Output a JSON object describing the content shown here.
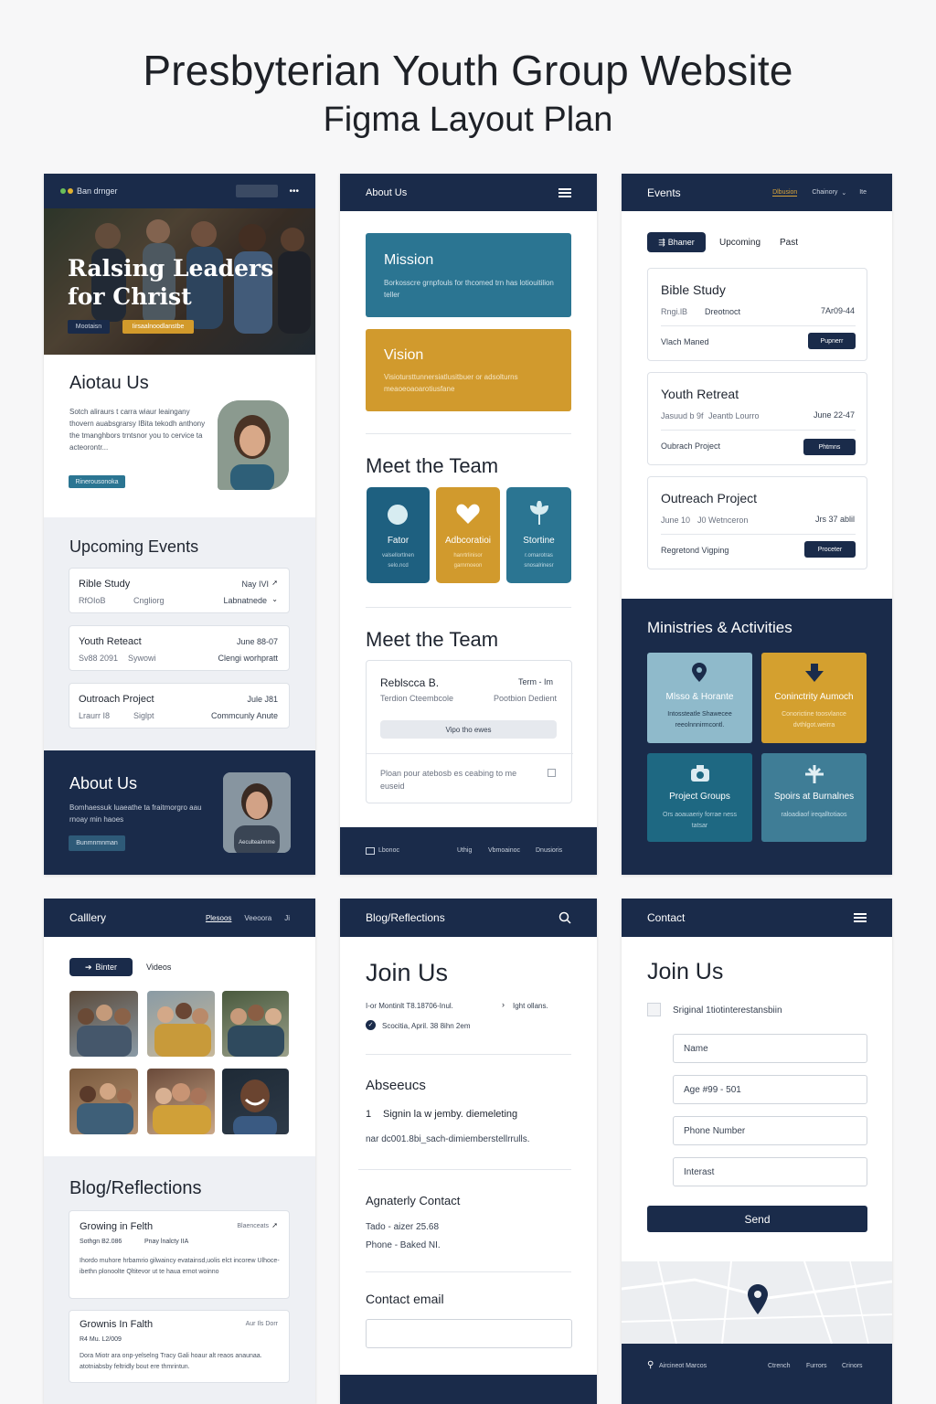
{
  "header": {
    "title": "Presbyterian Youth Group Website",
    "subtitle": "Figma Layout Plan"
  },
  "home": {
    "logo": "Ban drnger",
    "hero_title_1": "Ralsing Leaders",
    "hero_title_2": "for Christ",
    "hero_btn_1": "Mootaisn",
    "hero_btn_2": "Iirsaalnoodlanstbe",
    "about_title": "Aiotau Us",
    "about_text": "Sotch aliraurs t carra wiaur leaingany thovern auabsgrarsy IBita tekodh anthony the tmanghbors trntsnor you to cervice ta acteorontr...",
    "about_btn": "Rinerousonoka",
    "events_title": "Upcoming Events",
    "events": [
      {
        "name": "Rible Study",
        "date": "Nay IVI",
        "sub1": "RfOIoB",
        "sub2": "Cngliorg",
        "sub3": "Labnatnede"
      },
      {
        "name": "Youth Reteact",
        "date": "June 88-07",
        "sub1": "Sv88 2091",
        "sub2": "Sywowi",
        "sub3": "Clengi worhpratt"
      },
      {
        "name": "Outroach Project",
        "date": "Jule J81",
        "sub1": "Lraurr I8",
        "sub2": "Siglpt",
        "sub3": "Commcunly Anute"
      }
    ],
    "about2_title": "About Us",
    "about2_text": "Bomhaessuk luaeathe ta fraitmorgro aau rnoay min haoes",
    "about2_btn": "Bunmnmnman",
    "about2_caption": "Aeculteainnme"
  },
  "about": {
    "nav_title": "About Us",
    "mission_title": "Mission",
    "mission_text": "Borkosscre grnpfouls for thcomed trn has lotiouitilion teller",
    "vision_title": "Vision",
    "vision_text": "Visiotursttunnersiatlusitbuer or adsolturns meaoeoaoarotiusfane",
    "team_title": "Meet the Team",
    "team": [
      {
        "name": "Fator",
        "text": "valsellortlnen selo.ncd",
        "color": "#1e6080"
      },
      {
        "name": "Adbcoratioi",
        "text": "hanrtrlinisor garnrnoeon",
        "color": "#d19a2d"
      },
      {
        "name": "Stortine",
        "text": "r.ornarotras snosalrinesr",
        "color": "#2b7592"
      }
    ],
    "team2_title": "Meet the Team",
    "member_name": "Reblscca B.",
    "member_role_right": "Term - Im",
    "member_sub": "Terdion Cteembcole",
    "member_sub_right": "Pootbion Dedient",
    "member_btn": "Vipo tho ewes",
    "member_note": "Ploan pour atebosb es ceabing to me euseid",
    "footer_logo": "Lbonoc",
    "footer_links": [
      "Uthig",
      "Vbmoainoc",
      "Dnusioris"
    ]
  },
  "events": {
    "nav_title": "Events",
    "nav_links": [
      "Dlbusion",
      "Chainory",
      "Ite"
    ],
    "tabs": [
      "Bhaner",
      "Upcoming",
      "Past"
    ],
    "list": [
      {
        "name": "Bible Study",
        "sub1": "Rngi.lB",
        "sub2": "Dreotnoct",
        "date": "7Ar09-44",
        "foot": "Vlach Maned",
        "btn": "Pupnerr"
      },
      {
        "name": "Youth Retreat",
        "sub1": "Jasuud b 9f",
        "sub2": "Jeantb Lourro",
        "date": "June 22-47",
        "foot": "Oubrach Project",
        "btn": "Phtmns"
      },
      {
        "name": "Outreach Project",
        "sub1": "June 10",
        "sub2": "J0 Wetnceron",
        "date": "Jrs 37 ablil",
        "foot": "Regretond Vigping",
        "btn": "Proceter"
      }
    ],
    "ministries_title": "Ministries & Activities",
    "ministries": [
      {
        "name": "Mlsso & Horante",
        "text": "Intossteatle Shawecee reeolnnnirmcontl.",
        "color": "#8fbacb",
        "icon": "pin-icon"
      },
      {
        "name": "Coninctrity Aumoch",
        "text": "Conorictine toosvlance dvthlgot.weirra",
        "color": "#d4a02f",
        "icon": "dove-icon"
      },
      {
        "name": "Project Groups",
        "text": "Ors aoauaeriy forrae ness tatsar",
        "color": "#1e6882",
        "icon": "camera-icon"
      },
      {
        "name": "Spoirs at Burnalnes",
        "text": "raloadiaof ireqalltotiaos",
        "color": "#3f7d96",
        "icon": "plane-icon"
      }
    ]
  },
  "gallery": {
    "nav_title": "Calllery",
    "nav_links": [
      "Plesoos",
      "Veeoora",
      "Ji"
    ],
    "tabs": [
      "Binter",
      "Videos"
    ],
    "blog_title": "Blog/Reflections",
    "posts": [
      {
        "title": "Growing in Felth",
        "right": "Blaenceats",
        "meta1": "Sothgn B2.086",
        "meta2": "Pnay lnalcty IIA",
        "text": "Ihordo muhore hrbamrio gilwaincy evatainsd,uolis elct incorew Ulhoce-ibethn plonoolte Qltitevor ut te haua ernot woinno"
      },
      {
        "title": "Grownis In Falth",
        "right": "Aur Ils Dorr",
        "meta1": "R4 Mu. L2/009",
        "meta2": "",
        "text": "Dora Miotr ara onp-yelselng Tracy Gali hoaur alt reaos anaunaa. atotniabsby feltridly bout ere thmrintun."
      }
    ]
  },
  "blog": {
    "nav_title": "Blog/Reflections",
    "join_title": "Join Us",
    "line1": "I-or Montinlt T8.18706-Inul.",
    "line1_right": "Ight ollans.",
    "line2": "Scocitia, April. 38 8ihn 2em",
    "section2": "Abseeucs",
    "step_num": "1",
    "step_text": "Signin la w jemby. diemeleting",
    "step_sub": "nar dc001.8bi_sach-dimiemberstellrrulls.",
    "contact_title": "Agnaterly Contact",
    "contact_1": "Tado - aizer 25.68",
    "contact_2": "Phone - Baked NI.",
    "email_label": "Contact email"
  },
  "contact": {
    "nav_title": "Contact",
    "join_title": "Join Us",
    "checkbox_label": "Sriginal 1tiotinterestansbiin",
    "fields": [
      "Name",
      "Age #99 - 501",
      "Phone Number",
      "Interast"
    ],
    "send": "Send",
    "footer_addr": "Aircineot Marcos",
    "footer_links": [
      "Ctrench",
      "Furrors",
      "Crinors"
    ]
  }
}
